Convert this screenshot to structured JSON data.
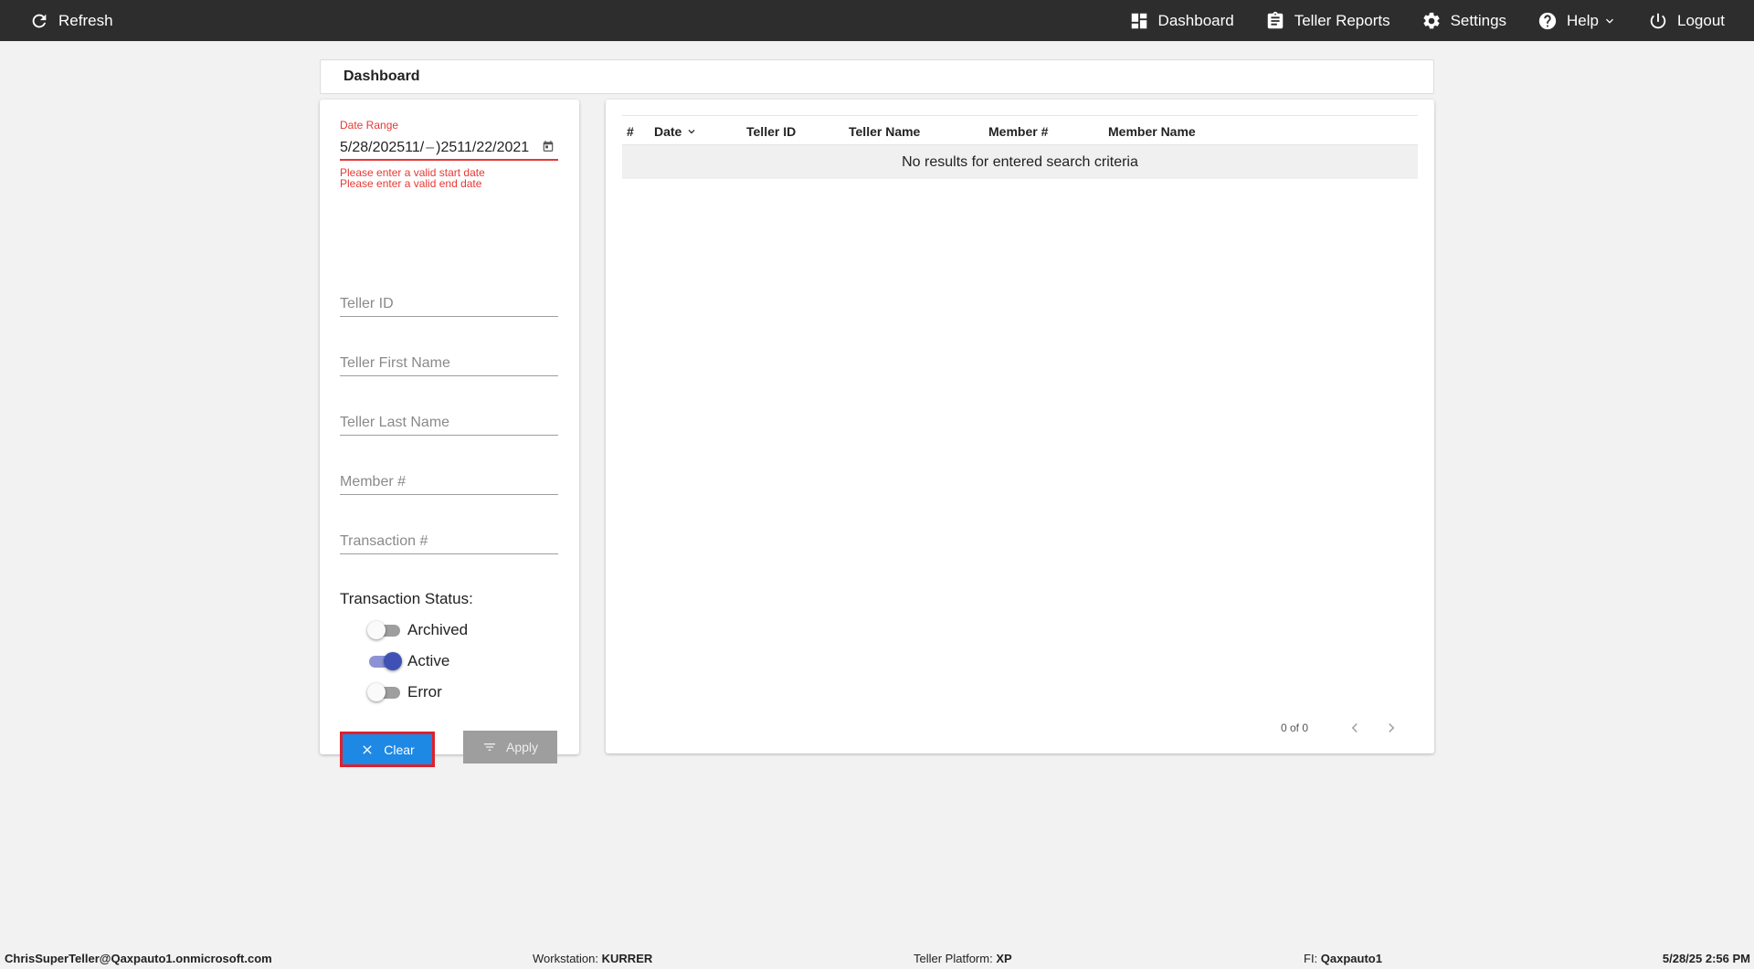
{
  "topbar": {
    "refresh_label": "Refresh",
    "nav": [
      {
        "label": "Dashboard",
        "icon": "dashboard-icon"
      },
      {
        "label": "Teller Reports",
        "icon": "clipboard-icon"
      },
      {
        "label": "Settings",
        "icon": "gear-icon"
      },
      {
        "label": "Help",
        "icon": "help-icon"
      },
      {
        "label": "Logout",
        "icon": "power-icon"
      }
    ]
  },
  "page": {
    "title": "Dashboard"
  },
  "filters": {
    "date_range_label": "Date Range",
    "date_start_value": "5/28/202511/",
    "date_separator": "–",
    "date_end_value": ")2511/22/2021",
    "errors": [
      "Please enter a valid start date",
      "Please enter a valid end date"
    ],
    "teller_id_placeholder": "Teller ID",
    "teller_first_placeholder": "Teller First Name",
    "teller_last_placeholder": "Teller Last Name",
    "member_placeholder": "Member #",
    "transaction_placeholder": "Transaction #",
    "status_label": "Transaction Status:",
    "statuses": [
      {
        "label": "Archived",
        "on": false
      },
      {
        "label": "Active",
        "on": true
      },
      {
        "label": "Error",
        "on": false
      }
    ],
    "clear_label": "Clear",
    "apply_label": "Apply"
  },
  "table": {
    "columns": [
      "#",
      "Date",
      "Teller ID",
      "Teller Name",
      "Member #",
      "Member Name"
    ],
    "empty_message": "No results for entered search criteria",
    "pager_text": "0 of 0"
  },
  "statusbar": {
    "user": "ChrisSuperTeller@Qaxpauto1.onmicrosoft.com",
    "workstation_key": "Workstation:",
    "workstation_value": "KURRER",
    "platform_key": "Teller Platform:",
    "platform_value": "XP",
    "fi_key": "FI:",
    "fi_value": "Qaxpauto1",
    "datetime": "5/28/25 2:56 PM"
  },
  "colors": {
    "topbar": "#2d2d2d",
    "error": "#e53935",
    "primary": "#1e88e5",
    "toggle_on": "#3f51b5"
  }
}
